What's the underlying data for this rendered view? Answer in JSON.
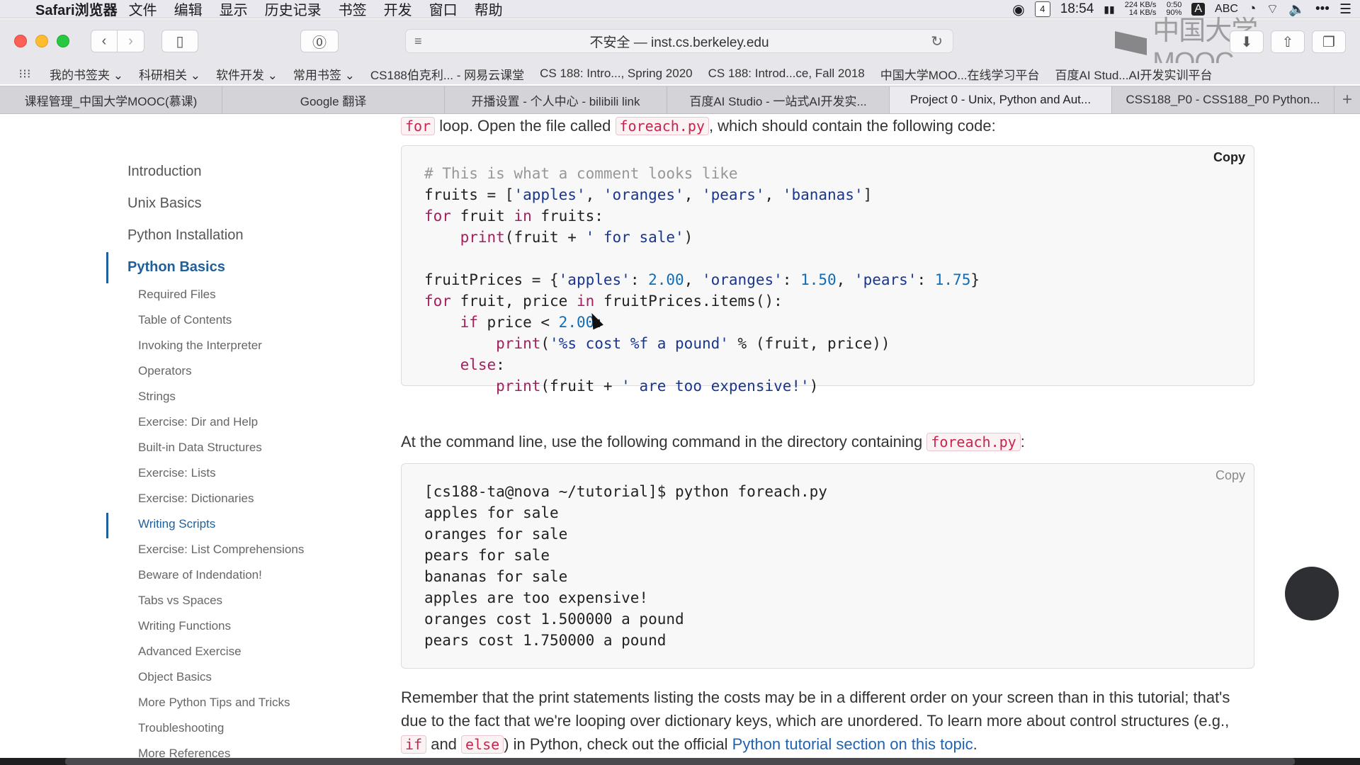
{
  "menubar": {
    "app_name": "Safari浏览器",
    "items": [
      "文件",
      "编辑",
      "显示",
      "历史记录",
      "书签",
      "开发",
      "窗口",
      "帮助"
    ],
    "clock": "18:54",
    "calendar_day": "4",
    "net_up": "224 KB/s",
    "net_down": "14 KB/s",
    "battery_time": "0:50",
    "battery_pct": "90%",
    "input_letter": "A",
    "input_method": "ABC"
  },
  "toolbar": {
    "url_text": "不安全 — inst.cs.berkeley.edu",
    "watermark_text": "中国大学MOOC"
  },
  "bookmarks": [
    "我的书签夹 ⌄",
    "科研相关 ⌄",
    "软件开发 ⌄",
    "常用书签 ⌄",
    "CS188伯克利... - 网易云课堂",
    "CS 188: Intro..., Spring 2020",
    "CS 188: Introd...ce, Fall 2018",
    "中国大学MOO...在线学习平台",
    "百度AI Stud...AI开发实训平台"
  ],
  "tabs": [
    {
      "label": "课程管理_中国大学MOOC(慕课)",
      "active": false
    },
    {
      "label": "Google 翻译",
      "active": false
    },
    {
      "label": "开播设置 - 个人中心 - bilibili link",
      "active": false
    },
    {
      "label": "百度AI Studio - 一站式AI开发实...",
      "active": false
    },
    {
      "label": "Project 0 - Unix, Python and Aut...",
      "active": true
    },
    {
      "label": "CSS188_P0 - CSS188_P0 Python...",
      "active": false
    }
  ],
  "toc": {
    "top_items": [
      "Introduction",
      "Unix Basics",
      "Python Installation",
      "Python Basics"
    ],
    "active_top": "Python Basics",
    "sub_items": [
      "Required Files",
      "Table of Contents",
      "Invoking the Interpreter",
      "Operators",
      "Strings",
      "Exercise: Dir and Help",
      "Built-in Data Structures",
      "Exercise: Lists",
      "Exercise: Dictionaries",
      "Writing Scripts",
      "Exercise: List Comprehensions",
      "Beware of Indendation!",
      "Tabs vs Spaces",
      "Writing Functions",
      "Advanced Exercise",
      "Object Basics",
      "More Python Tips and Tricks",
      "Troubleshooting",
      "More References"
    ],
    "active_sub": "Writing Scripts"
  },
  "content": {
    "intro_code_word": "for",
    "intro_text_1": " loop. Open the file called ",
    "intro_file": "foreach.py",
    "intro_text_2": ", which should contain the following code:",
    "copy_label": "Copy",
    "cmd_text": "At the command line, use the following command in the directory containing ",
    "cmd_file": "foreach.py",
    "cmd_colon": ":",
    "output_lines": [
      "[cs188-ta@nova ~/tutorial]$ python foreach.py",
      "apples for sale",
      "oranges for sale",
      "pears for sale",
      "bananas for sale",
      "apples are too expensive!",
      "oranges cost 1.500000 a pound",
      "pears cost 1.750000 a pound"
    ],
    "remember_1": "Remember that the print statements listing the costs may be in a different order on your screen than in this tutorial; that's",
    "remember_2": "due to the fact that we're looping over dictionary keys, which are unordered. To learn more about control structures (e.g.,",
    "kw_if": "if",
    "and_word": " and ",
    "kw_else": "else",
    "remember_3": ") in Python, check out the official ",
    "tutorial_link": "Python tutorial section on this topic",
    "period": "."
  }
}
